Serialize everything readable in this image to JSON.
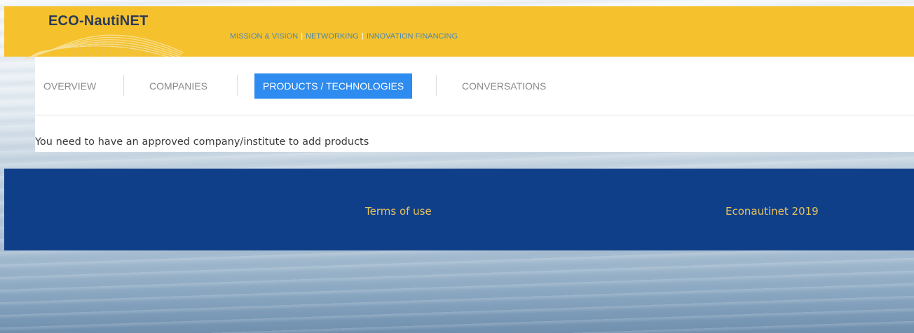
{
  "brand": {
    "name": "ECO-NautiNET"
  },
  "top_nav": {
    "items": [
      {
        "label": "MISSION & VISION"
      },
      {
        "label": "NETWORKING"
      },
      {
        "label": "INNOVATION FINANCING"
      }
    ]
  },
  "tabs": [
    {
      "label": "OVERVIEW",
      "active": false
    },
    {
      "label": "COMPANIES",
      "active": false
    },
    {
      "label": "PRODUCTS / TECHNOLOGIES",
      "active": true
    },
    {
      "label": "CONVERSATIONS",
      "active": false
    }
  ],
  "main": {
    "message": "You need to have an approved company/institute to add products"
  },
  "footer": {
    "terms_label": "Terms of use",
    "copyright": "Econautinet 2019"
  },
  "colors": {
    "header_bg": "#f5c22e",
    "nav_link": "#4a86b8",
    "active_tab": "#2e8bef",
    "footer_bg": "#103f8a",
    "footer_text": "#e6c25c"
  }
}
